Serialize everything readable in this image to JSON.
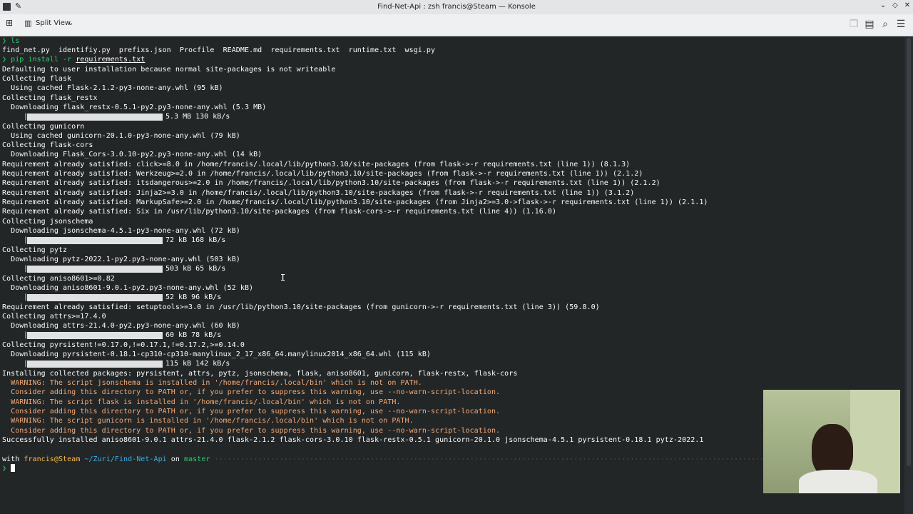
{
  "window": {
    "title": "Find-Net-Api : zsh francis@Steam — Konsole"
  },
  "toolbar": {
    "split_view_label": "Split View"
  },
  "terminal": {
    "cmd1": "ls",
    "ls_output": "find_net.py  identifiy.py  prefixs.json  Procfile  README.md  requirements.txt  runtime.txt  wsgi.py",
    "cmd2_prefix": "pip install -r ",
    "cmd2_file": "requirements.txt",
    "lines": [
      "Defaulting to user installation because normal site-packages is not writeable",
      "Collecting flask",
      "  Using cached Flask-2.1.2-py3-none-any.whl (95 kB)",
      "Collecting flask_restx",
      "  Downloading flask_restx-0.5.1-py2.py3-none-any.whl (5.3 MB)",
      "Collecting gunicorn",
      "  Using cached gunicorn-20.1.0-py3-none-any.whl (79 kB)",
      "Collecting flask-cors",
      "  Downloading Flask_Cors-3.0.10-py2.py3-none-any.whl (14 kB)",
      "Requirement already satisfied: click>=8.0 in /home/francis/.local/lib/python3.10/site-packages (from flask->-r requirements.txt (line 1)) (8.1.3)",
      "Requirement already satisfied: Werkzeug>=2.0 in /home/francis/.local/lib/python3.10/site-packages (from flask->-r requirements.txt (line 1)) (2.1.2)",
      "Requirement already satisfied: itsdangerous>=2.0 in /home/francis/.local/lib/python3.10/site-packages (from flask->-r requirements.txt (line 1)) (2.1.2)",
      "Requirement already satisfied: Jinja2>=3.0 in /home/francis/.local/lib/python3.10/site-packages (from flask->-r requirements.txt (line 1)) (3.1.2)",
      "Requirement already satisfied: MarkupSafe>=2.0 in /home/francis/.local/lib/python3.10/site-packages (from Jinja2>=3.0->flask->-r requirements.txt (line 1)) (2.1.1)",
      "Requirement already satisfied: Six in /usr/lib/python3.10/site-packages (from flask-cors->-r requirements.txt (line 4)) (1.16.0)",
      "Collecting jsonschema",
      "  Downloading jsonschema-4.5.1-py3-none-any.whl (72 kB)",
      "Collecting pytz",
      "  Downloading pytz-2022.1-py2.py3-none-any.whl (503 kB)",
      "Collecting aniso8601>=0.82",
      "  Downloading aniso8601-9.0.1-py2.py3-none-any.whl (52 kB)",
      "Requirement already satisfied: setuptools>=3.0 in /usr/lib/python3.10/site-packages (from gunicorn->-r requirements.txt (line 3)) (59.8.0)",
      "Collecting attrs>=17.4.0",
      "  Downloading attrs-21.4.0-py2.py3-none-any.whl (60 kB)",
      "Collecting pyrsistent!=0.17.0,!=0.17.1,!=0.17.2,>=0.14.0",
      "  Downloading pyrsistent-0.18.1-cp310-cp310-manylinux_2_17_x86_64.manylinux2014_x86_64.whl (115 kB)",
      "Installing collected packages: pyrsistent, attrs, pytz, jsonschema, flask, aniso8601, gunicorn, flask-restx, flask-cors",
      "Successfully installed aniso8601-9.0.1 attrs-21.4.0 flask-2.1.2 flask-cors-3.0.10 flask-restx-0.5.1 gunicorn-20.1.0 jsonschema-4.5.1 pyrsistent-0.18.1 pytz-2022.1"
    ],
    "progress": [
      "5.3 MB 130 kB/s",
      "72 kB 168 kB/s",
      "503 kB 65 kB/s",
      "52 kB 96 kB/s",
      "60 kB 78 kB/s",
      "115 kB 142 kB/s"
    ],
    "warnings": [
      "  WARNING: The script jsonschema is installed in '/home/francis/.local/bin' which is not on PATH.",
      "  Consider adding this directory to PATH or, if you prefer to suppress this warning, use --no-warn-script-location.",
      "  WARNING: The script flask is installed in '/home/francis/.local/bin' which is not on PATH.",
      "  Consider adding this directory to PATH or, if you prefer to suppress this warning, use --no-warn-script-location.",
      "  WARNING: The script gunicorn is installed in '/home/francis/.local/bin' which is not on PATH.",
      "  Consider adding this directory to PATH or, if you prefer to suppress this warning, use --no-warn-script-location."
    ],
    "prompt": {
      "with": "with",
      "user": "francis@Steam",
      "path": "~/Zuri/Find-Net-Api",
      "on": "on",
      "branch": "master"
    }
  },
  "icons": {
    "app": "konsole-icon",
    "pin": "pin-icon",
    "new_tab": "new-tab-icon",
    "split": "split-view-icon",
    "copy": "copy-icon",
    "paste": "paste-icon",
    "search": "search-icon",
    "menu": "hamburger-menu-icon"
  }
}
